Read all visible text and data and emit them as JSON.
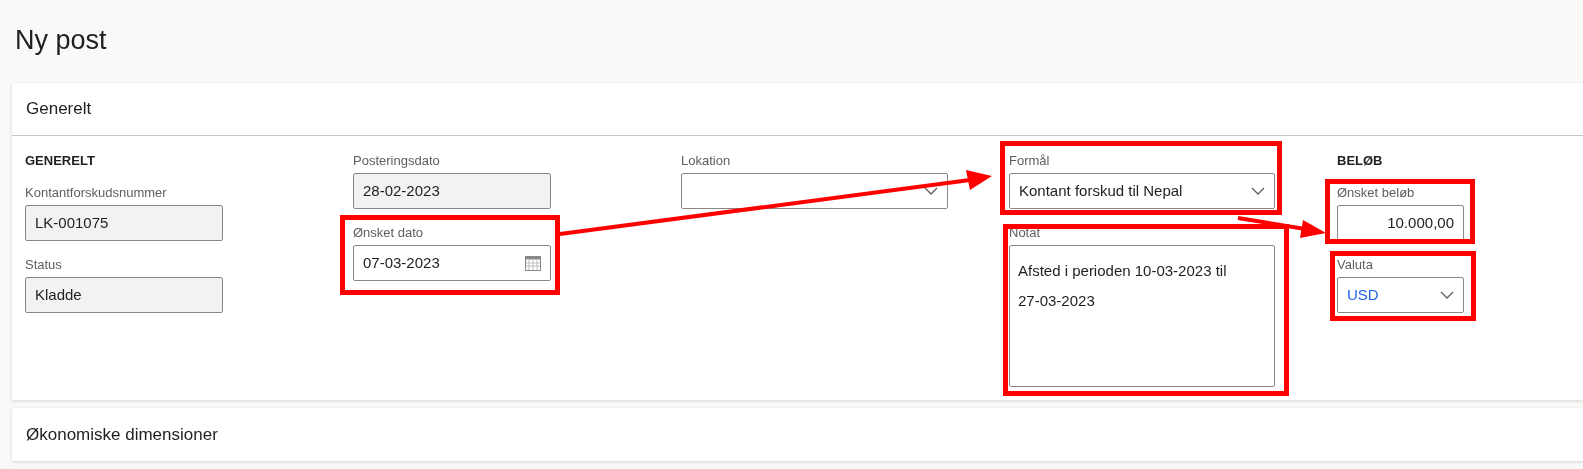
{
  "page_title": "Ny post",
  "general": {
    "title": "Generelt",
    "columns": [
      {
        "heading": "GENERELT",
        "fields": [
          {
            "label": "Kontantforskudsnummer",
            "kind": "readonly",
            "value": "LK-001075"
          },
          {
            "label": "Status",
            "kind": "readonly",
            "value": "Kladde"
          }
        ]
      },
      {
        "fields": [
          {
            "label": "Posteringsdato",
            "kind": "readonly",
            "value": "28-02-2023"
          },
          {
            "label": "Ønsket dato",
            "kind": "date",
            "value": "07-03-2023"
          }
        ]
      },
      {
        "fields": [
          {
            "label": "Lokation",
            "kind": "dropdown"
          }
        ]
      },
      {
        "fields": [
          {
            "label": "Formål",
            "kind": "dropdown",
            "value": "Kontant forskud til Nepal"
          },
          {
            "label": "Notat",
            "kind": "textarea",
            "value": "Afsted i perioden 10-03-2023 til 27-03-2023"
          }
        ]
      },
      {
        "heading": "BELØB",
        "fields": [
          {
            "label": "Ønsket beløb",
            "kind": "number",
            "value": "10.000,00"
          },
          {
            "label": "Valuta",
            "kind": "dropdown",
            "value": "USD",
            "link": true
          }
        ]
      }
    ]
  },
  "dimensions": {
    "title": "Økonomiske dimensioner"
  }
}
